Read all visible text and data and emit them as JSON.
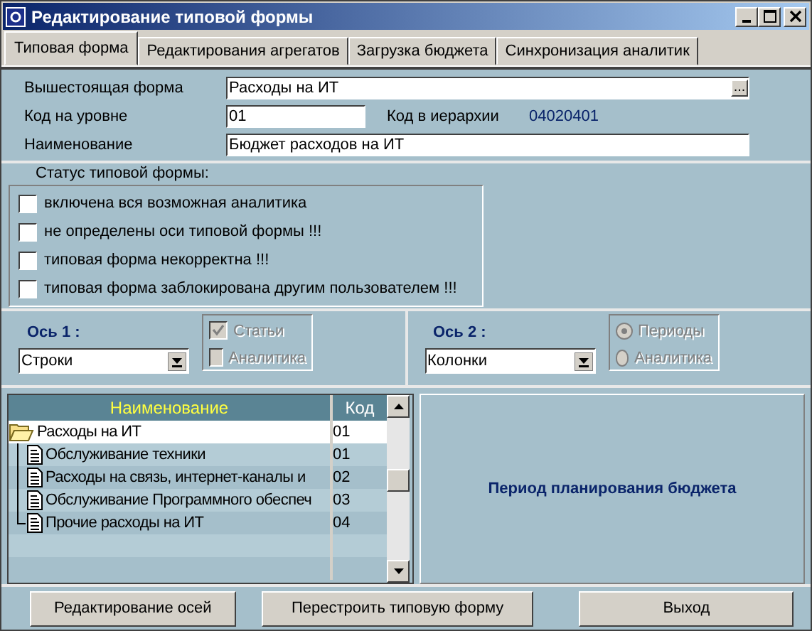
{
  "window": {
    "title": "Редактирование типовой формы"
  },
  "tabs": [
    {
      "label": "Типовая форма",
      "selected": true
    },
    {
      "label": "Редактирования агрегатов",
      "selected": false
    },
    {
      "label": "Загрузка бюджета",
      "selected": false
    },
    {
      "label": "Синхронизация аналитик",
      "selected": false
    }
  ],
  "form": {
    "parent_label": "Вышестоящая форма",
    "parent_value": "Расходы на ИТ",
    "browse": "...",
    "level_code_label": "Код на уровне",
    "level_code_value": "01",
    "hierarchy_label": "Код в иерархии",
    "hierarchy_value": "04020401",
    "name_label": "Наименование",
    "name_value": "Бюджет расходов на ИТ"
  },
  "status": {
    "title": "Статус типовой формы:",
    "items": [
      {
        "label": "включена вся возможная аналитика",
        "checked": false
      },
      {
        "label": "не определены оси типовой формы !!!",
        "checked": false
      },
      {
        "label": "типовая форма некорректна !!!",
        "checked": false
      },
      {
        "label": "типовая форма заблокирована другим пользователем !!!",
        "checked": false
      }
    ]
  },
  "axes": [
    {
      "label": "Ось 1 :",
      "value": "Строки",
      "options": [
        {
          "kind": "checkbox",
          "label": "Статьи",
          "checked": true,
          "disabled": true
        },
        {
          "kind": "checkbox",
          "label": "Аналитика",
          "checked": false,
          "disabled": true
        }
      ]
    },
    {
      "label": "Ось 2 :",
      "value": "Колонки",
      "options": [
        {
          "kind": "radio",
          "label": "Периоды",
          "checked": true,
          "disabled": true
        },
        {
          "kind": "radio",
          "label": "Аналитика",
          "checked": false,
          "disabled": true
        }
      ]
    }
  ],
  "tree": {
    "columns": [
      "Наименование",
      "Код"
    ],
    "rows": [
      {
        "name": "Расходы на ИТ",
        "code": "01",
        "selected": true,
        "children": [
          {
            "name": "Обслуживание техники",
            "code": "01",
            "selected": false
          },
          {
            "name": "Расходы на связь, интернет-каналы и",
            "code": "02",
            "selected": false
          },
          {
            "name": "Обслуживание Программного обеспеч",
            "code": "03",
            "selected": false
          },
          {
            "name": "Прочие расходы на ИТ",
            "code": "04",
            "selected": false
          }
        ]
      }
    ]
  },
  "period_panel": {
    "title": "Период планирования бюджета"
  },
  "buttons": [
    "Редактирование осей",
    "Перестроить типовую форму",
    "Выход"
  ]
}
